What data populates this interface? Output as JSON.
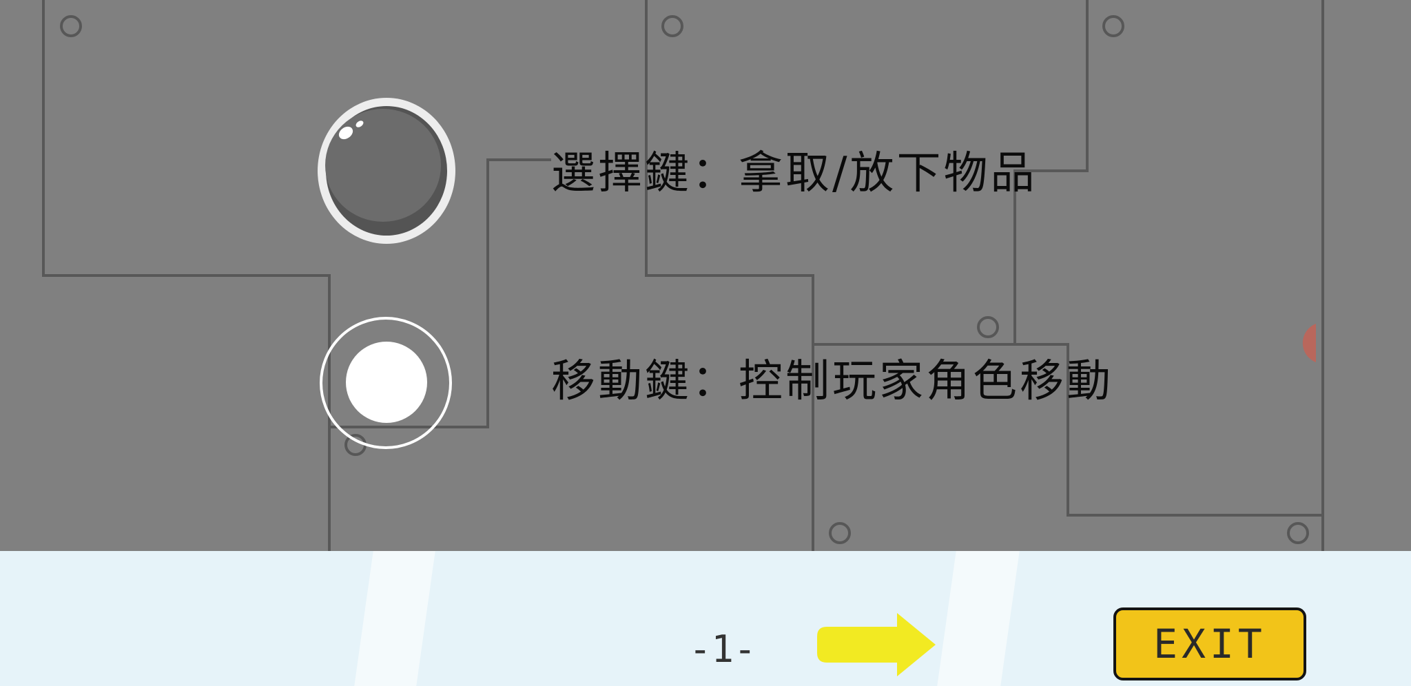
{
  "instructions": {
    "select_button": "選擇鍵：拿取/放下物品",
    "move_button": "移動鍵：控制玩家角色移動"
  },
  "pager": {
    "page_label": "-1-"
  },
  "buttons": {
    "exit_label": "EXIT"
  },
  "colors": {
    "overlay_gray": "#808080",
    "panel_line": "#575757",
    "footer_bg": "#e6f3f9",
    "arrow_yellow": "#f2ea22",
    "exit_yellow": "#f2c419"
  },
  "icons": {
    "select_button": "select-button-icon",
    "move_button": "joystick-icon",
    "next": "arrow-right-icon"
  }
}
